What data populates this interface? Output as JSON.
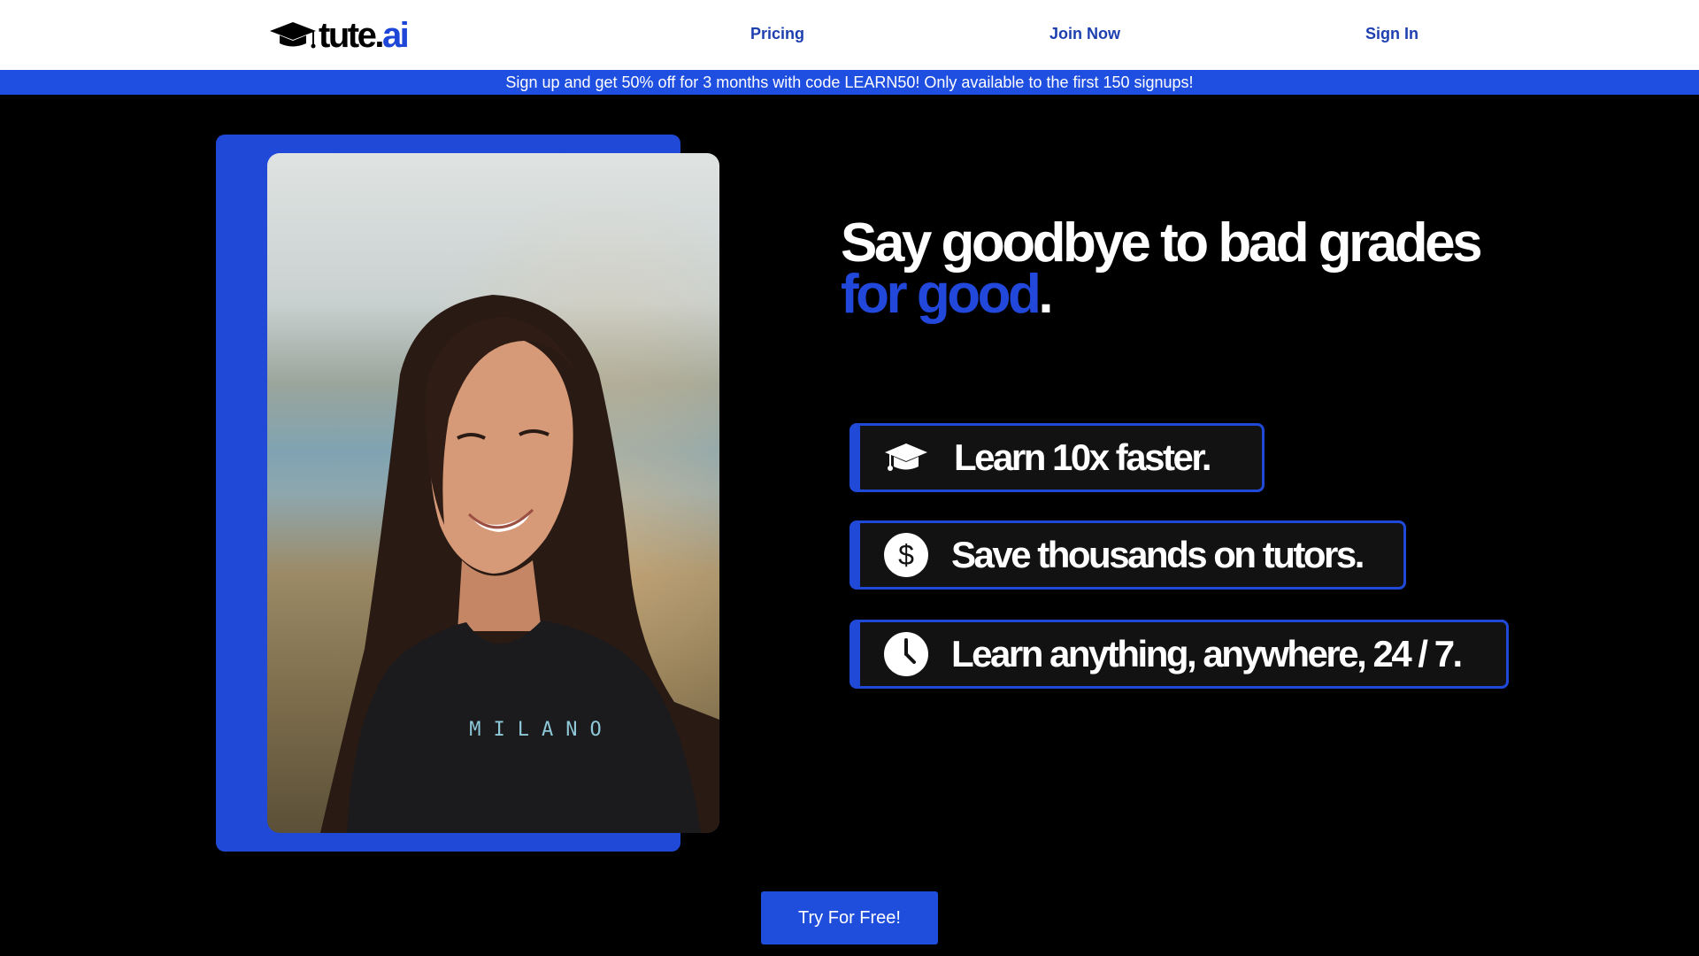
{
  "nav": {
    "logo_main": "tute.",
    "logo_accent": "ai",
    "links": [
      "Pricing",
      "Join Now",
      "Sign In"
    ]
  },
  "banner": {
    "text": "Sign up and get 50% off for 3 months with code LEARN50! Only available to the first 150 signups!"
  },
  "hero": {
    "headline_line1": "Say goodbye to bad grades",
    "headline_accent": "for good",
    "headline_end": ".",
    "photo_shirt_text": "MILANO"
  },
  "features": [
    {
      "icon": "graduation-cap-icon",
      "text": "Learn 10x faster."
    },
    {
      "icon": "dollar-icon",
      "text": "Save thousands on tutors."
    },
    {
      "icon": "clock-icon",
      "text": "Learn anything, anywhere, 24 / 7."
    }
  ],
  "cta": {
    "label": "Try For Free!"
  },
  "colors": {
    "accent": "#1f49d6",
    "nav_link": "#1e3fb0",
    "background": "#000000"
  }
}
